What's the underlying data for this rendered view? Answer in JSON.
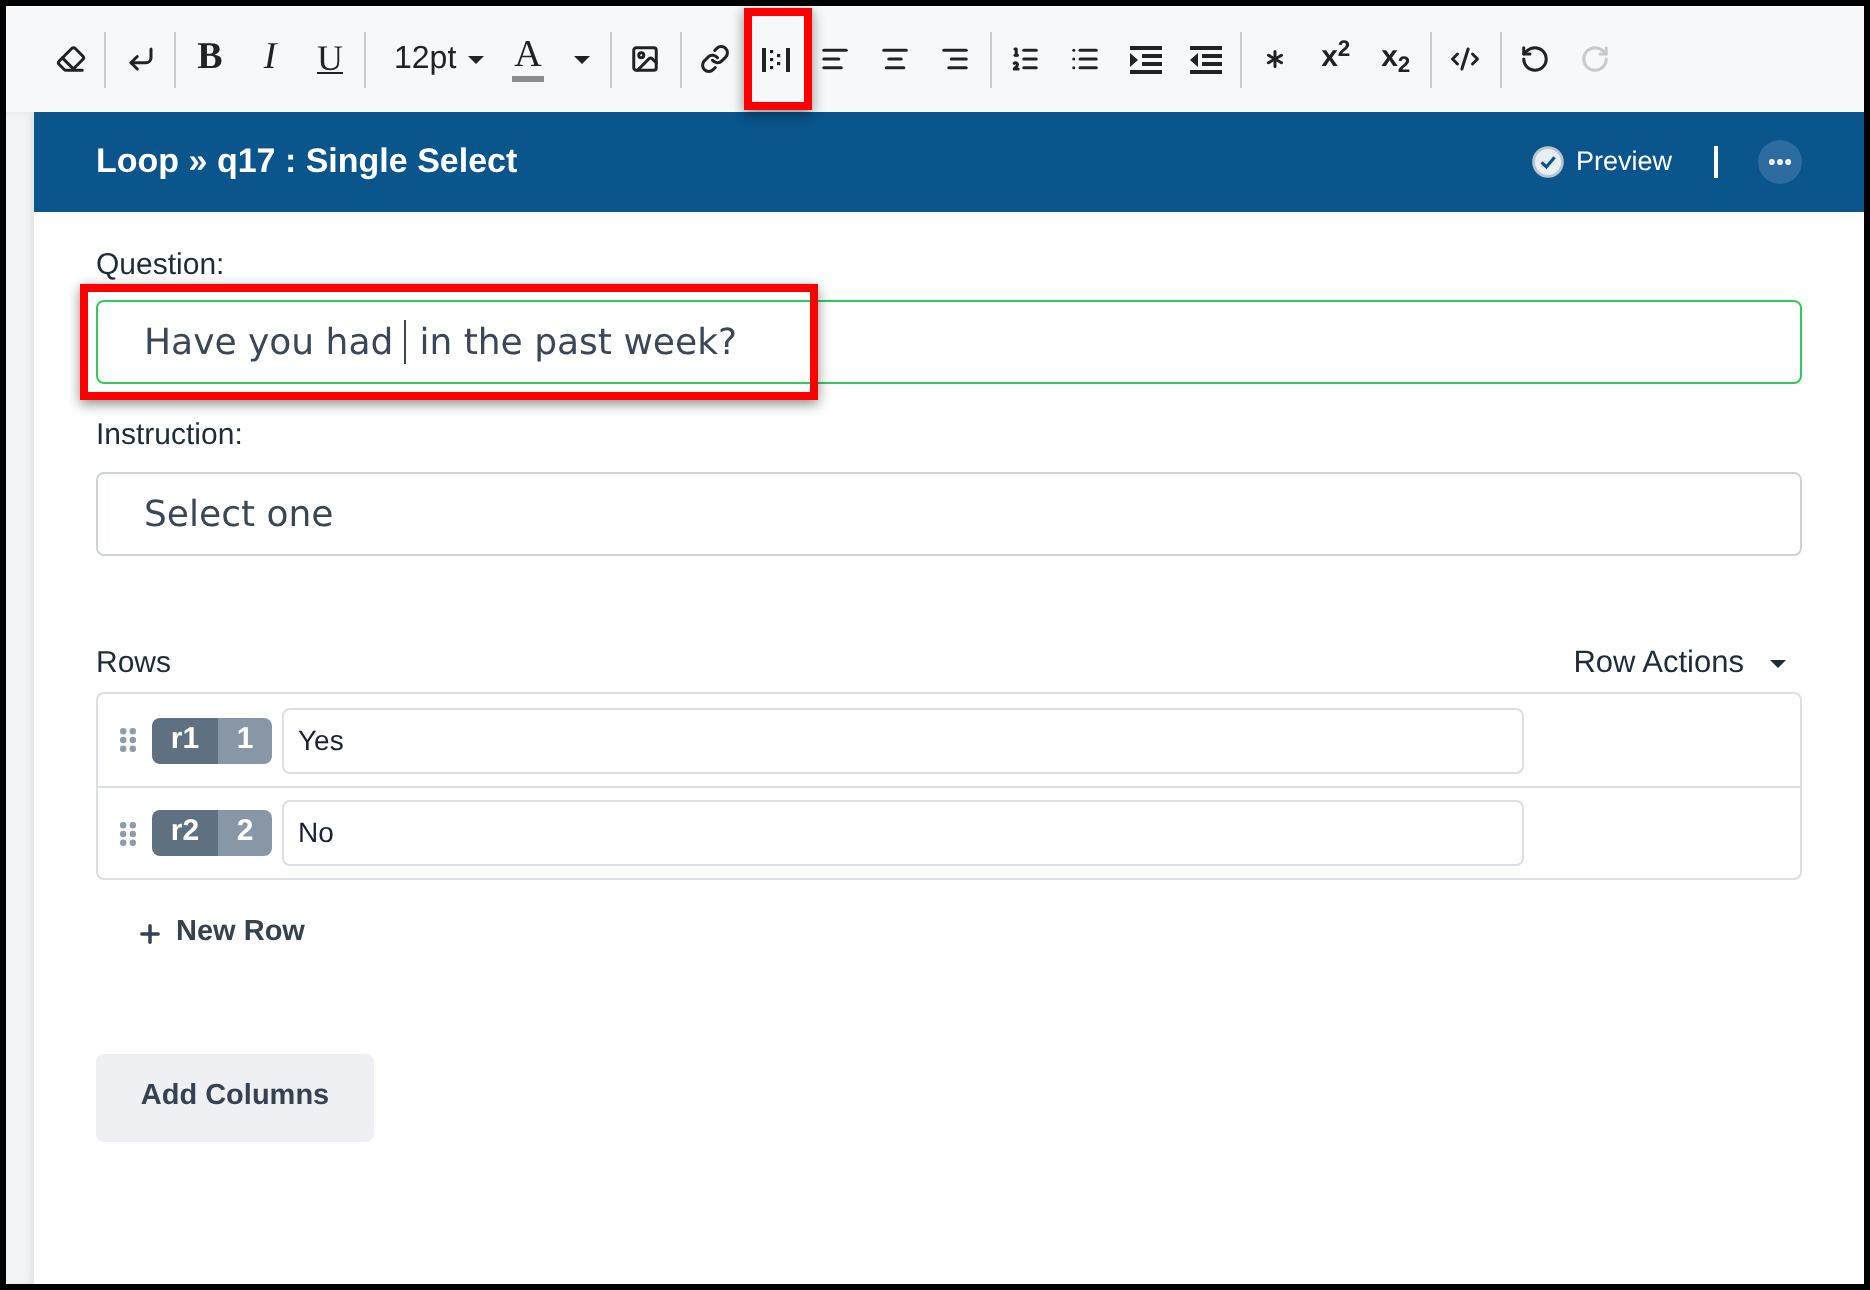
{
  "toolbar": [
    {
      "items": [
        {
          "kind": "icon",
          "disabled": false,
          "highlighted": false
        }
      ]
    },
    {
      "items": [
        {
          "kind": "icon",
          "disabled": false,
          "highlighted": false
        }
      ]
    },
    {
      "items": [
        {
          "kind": "bold",
          "label": "B",
          "disabled": false,
          "highlighted": false
        },
        {
          "kind": "italic",
          "label": "I",
          "disabled": false,
          "highlighted": false
        },
        {
          "kind": "underline",
          "label": "U",
          "disabled": false,
          "highlighted": false
        }
      ]
    },
    {
      "items": [
        {
          "kind": "dropdown",
          "label": "12pt",
          "disabled": false,
          "highlighted": false
        },
        {
          "kind": "color",
          "label": "A",
          "disabled": false,
          "highlighted": false
        }
      ]
    },
    {
      "items": [
        {
          "kind": "icon",
          "disabled": false,
          "highlighted": false
        }
      ]
    },
    {
      "items": [
        {
          "kind": "icon",
          "disabled": false,
          "highlighted": false
        },
        {
          "kind": "icon",
          "disabled": false,
          "highlighted": true
        },
        {
          "kind": "icon",
          "disabled": false,
          "highlighted": false
        },
        {
          "kind": "icon",
          "disabled": false,
          "highlighted": false
        },
        {
          "kind": "icon",
          "disabled": false,
          "highlighted": false
        }
      ]
    },
    {
      "items": [
        {
          "kind": "icon",
          "disabled": false,
          "highlighted": false
        },
        {
          "kind": "icon",
          "disabled": false,
          "highlighted": false
        },
        {
          "kind": "icon",
          "disabled": false,
          "highlighted": false
        },
        {
          "kind": "icon",
          "disabled": false,
          "highlighted": false
        }
      ]
    },
    {
      "items": [
        {
          "kind": "icon",
          "disabled": false,
          "highlighted": false
        },
        {
          "kind": "script",
          "label": "x$^{2}$",
          "disabled": false,
          "highlighted": false
        },
        {
          "kind": "script",
          "label": "x$_{2}$",
          "disabled": false,
          "highlighted": false
        }
      ]
    },
    {
      "items": [
        {
          "kind": "icon",
          "disabled": false,
          "highlighted": false
        }
      ]
    },
    {
      "items": [
        {
          "kind": "icon",
          "disabled": false,
          "highlighted": false
        },
        {
          "kind": "icon",
          "disabled": true,
          "highlighted": false
        }
      ]
    }
  ],
  "panel": {
    "title": "Loop » q17 : Single Select",
    "preview": "Preview"
  },
  "question": {
    "label": "Question:",
    "text_before_cursor": "Have you had",
    "text_after_cursor": "in the past week?",
    "focused": true,
    "highlighted": true
  },
  "instruction": {
    "label": "Instruction:",
    "value": "Select one",
    "focused": false,
    "highlighted": false
  },
  "rows": {
    "label": "Rows",
    "actions": "Row Actions",
    "items": [
      {
        "code": "r1",
        "number": "1",
        "text": "Yes"
      },
      {
        "code": "r2",
        "number": "2",
        "text": "No"
      }
    ],
    "add_label": "New Row"
  },
  "add_columns": "Add Columns"
}
